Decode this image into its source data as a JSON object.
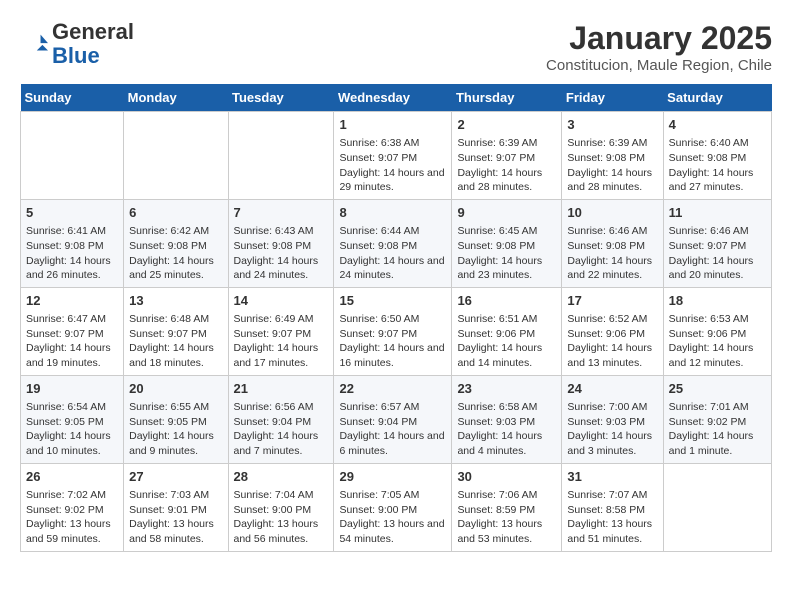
{
  "header": {
    "logo_line1": "General",
    "logo_line2": "Blue",
    "month": "January 2025",
    "location": "Constitucion, Maule Region, Chile"
  },
  "weekdays": [
    "Sunday",
    "Monday",
    "Tuesday",
    "Wednesday",
    "Thursday",
    "Friday",
    "Saturday"
  ],
  "weeks": [
    [
      {
        "day": "",
        "text": ""
      },
      {
        "day": "",
        "text": ""
      },
      {
        "day": "",
        "text": ""
      },
      {
        "day": "1",
        "text": "Sunrise: 6:38 AM\nSunset: 9:07 PM\nDaylight: 14 hours and 29 minutes."
      },
      {
        "day": "2",
        "text": "Sunrise: 6:39 AM\nSunset: 9:07 PM\nDaylight: 14 hours and 28 minutes."
      },
      {
        "day": "3",
        "text": "Sunrise: 6:39 AM\nSunset: 9:08 PM\nDaylight: 14 hours and 28 minutes."
      },
      {
        "day": "4",
        "text": "Sunrise: 6:40 AM\nSunset: 9:08 PM\nDaylight: 14 hours and 27 minutes."
      }
    ],
    [
      {
        "day": "5",
        "text": "Sunrise: 6:41 AM\nSunset: 9:08 PM\nDaylight: 14 hours and 26 minutes."
      },
      {
        "day": "6",
        "text": "Sunrise: 6:42 AM\nSunset: 9:08 PM\nDaylight: 14 hours and 25 minutes."
      },
      {
        "day": "7",
        "text": "Sunrise: 6:43 AM\nSunset: 9:08 PM\nDaylight: 14 hours and 24 minutes."
      },
      {
        "day": "8",
        "text": "Sunrise: 6:44 AM\nSunset: 9:08 PM\nDaylight: 14 hours and 24 minutes."
      },
      {
        "day": "9",
        "text": "Sunrise: 6:45 AM\nSunset: 9:08 PM\nDaylight: 14 hours and 23 minutes."
      },
      {
        "day": "10",
        "text": "Sunrise: 6:46 AM\nSunset: 9:08 PM\nDaylight: 14 hours and 22 minutes."
      },
      {
        "day": "11",
        "text": "Sunrise: 6:46 AM\nSunset: 9:07 PM\nDaylight: 14 hours and 20 minutes."
      }
    ],
    [
      {
        "day": "12",
        "text": "Sunrise: 6:47 AM\nSunset: 9:07 PM\nDaylight: 14 hours and 19 minutes."
      },
      {
        "day": "13",
        "text": "Sunrise: 6:48 AM\nSunset: 9:07 PM\nDaylight: 14 hours and 18 minutes."
      },
      {
        "day": "14",
        "text": "Sunrise: 6:49 AM\nSunset: 9:07 PM\nDaylight: 14 hours and 17 minutes."
      },
      {
        "day": "15",
        "text": "Sunrise: 6:50 AM\nSunset: 9:07 PM\nDaylight: 14 hours and 16 minutes."
      },
      {
        "day": "16",
        "text": "Sunrise: 6:51 AM\nSunset: 9:06 PM\nDaylight: 14 hours and 14 minutes."
      },
      {
        "day": "17",
        "text": "Sunrise: 6:52 AM\nSunset: 9:06 PM\nDaylight: 14 hours and 13 minutes."
      },
      {
        "day": "18",
        "text": "Sunrise: 6:53 AM\nSunset: 9:06 PM\nDaylight: 14 hours and 12 minutes."
      }
    ],
    [
      {
        "day": "19",
        "text": "Sunrise: 6:54 AM\nSunset: 9:05 PM\nDaylight: 14 hours and 10 minutes."
      },
      {
        "day": "20",
        "text": "Sunrise: 6:55 AM\nSunset: 9:05 PM\nDaylight: 14 hours and 9 minutes."
      },
      {
        "day": "21",
        "text": "Sunrise: 6:56 AM\nSunset: 9:04 PM\nDaylight: 14 hours and 7 minutes."
      },
      {
        "day": "22",
        "text": "Sunrise: 6:57 AM\nSunset: 9:04 PM\nDaylight: 14 hours and 6 minutes."
      },
      {
        "day": "23",
        "text": "Sunrise: 6:58 AM\nSunset: 9:03 PM\nDaylight: 14 hours and 4 minutes."
      },
      {
        "day": "24",
        "text": "Sunrise: 7:00 AM\nSunset: 9:03 PM\nDaylight: 14 hours and 3 minutes."
      },
      {
        "day": "25",
        "text": "Sunrise: 7:01 AM\nSunset: 9:02 PM\nDaylight: 14 hours and 1 minute."
      }
    ],
    [
      {
        "day": "26",
        "text": "Sunrise: 7:02 AM\nSunset: 9:02 PM\nDaylight: 13 hours and 59 minutes."
      },
      {
        "day": "27",
        "text": "Sunrise: 7:03 AM\nSunset: 9:01 PM\nDaylight: 13 hours and 58 minutes."
      },
      {
        "day": "28",
        "text": "Sunrise: 7:04 AM\nSunset: 9:00 PM\nDaylight: 13 hours and 56 minutes."
      },
      {
        "day": "29",
        "text": "Sunrise: 7:05 AM\nSunset: 9:00 PM\nDaylight: 13 hours and 54 minutes."
      },
      {
        "day": "30",
        "text": "Sunrise: 7:06 AM\nSunset: 8:59 PM\nDaylight: 13 hours and 53 minutes."
      },
      {
        "day": "31",
        "text": "Sunrise: 7:07 AM\nSunset: 8:58 PM\nDaylight: 13 hours and 51 minutes."
      },
      {
        "day": "",
        "text": ""
      }
    ]
  ]
}
